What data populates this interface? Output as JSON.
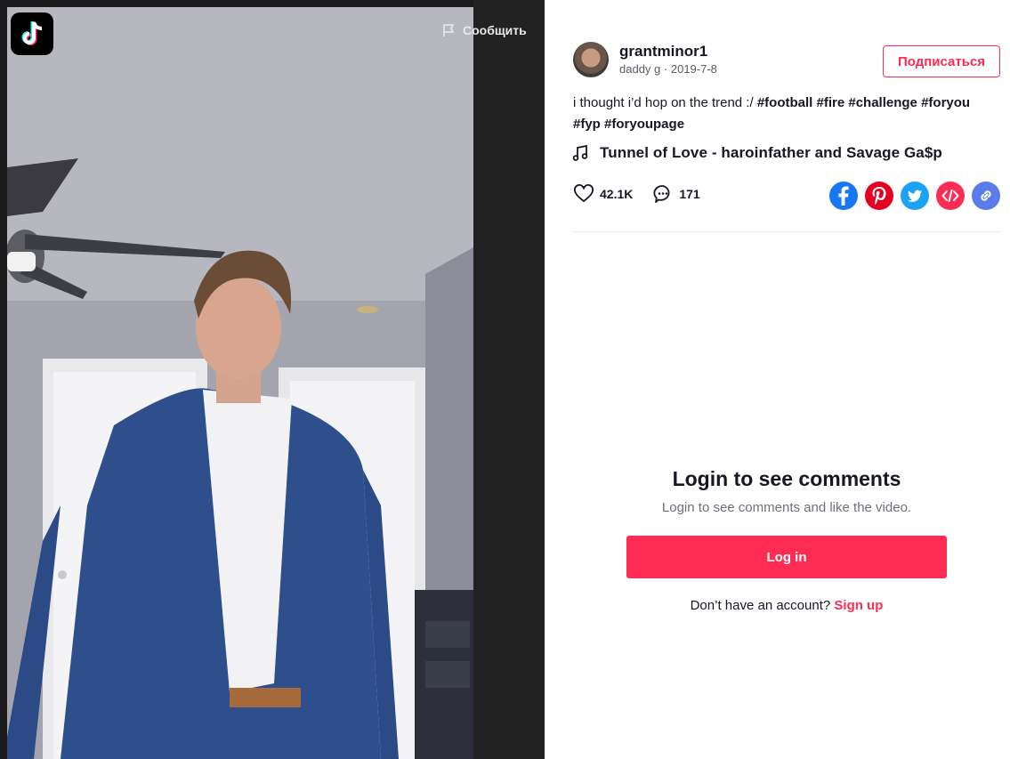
{
  "video": {
    "report_label": "Сообщить"
  },
  "author": {
    "username": "grantminor1",
    "nickname": "daddy g",
    "separator": "·",
    "date": "2019-7-8"
  },
  "follow_label": "Подписаться",
  "caption": {
    "text": "i thought i’d hop on the trend :/",
    "hashtags": [
      "#football",
      "#fire",
      "#challenge",
      "#foryou",
      "#fyp",
      "#foryoupage"
    ]
  },
  "music": {
    "title": "Tunnel of Love - haroinfather and Savage Ga$p"
  },
  "stats": {
    "likes": "42.1K",
    "comments": "171"
  },
  "share": [
    "facebook-icon",
    "pinterest-icon",
    "twitter-icon",
    "embed-icon",
    "link-icon"
  ],
  "comments_section": {
    "title": "Login to see comments",
    "subtitle": "Login to see comments and like the video.",
    "login_button": "Log in",
    "signup_prompt": "Don’t have an account?",
    "signup_link": "Sign up"
  },
  "colors": {
    "brand": "#fe2c55",
    "facebook": "#1877f2",
    "pinterest": "#e60023",
    "twitter": "#1da1f2",
    "embed": "#fe2c55",
    "link": "#5a7ce8"
  }
}
